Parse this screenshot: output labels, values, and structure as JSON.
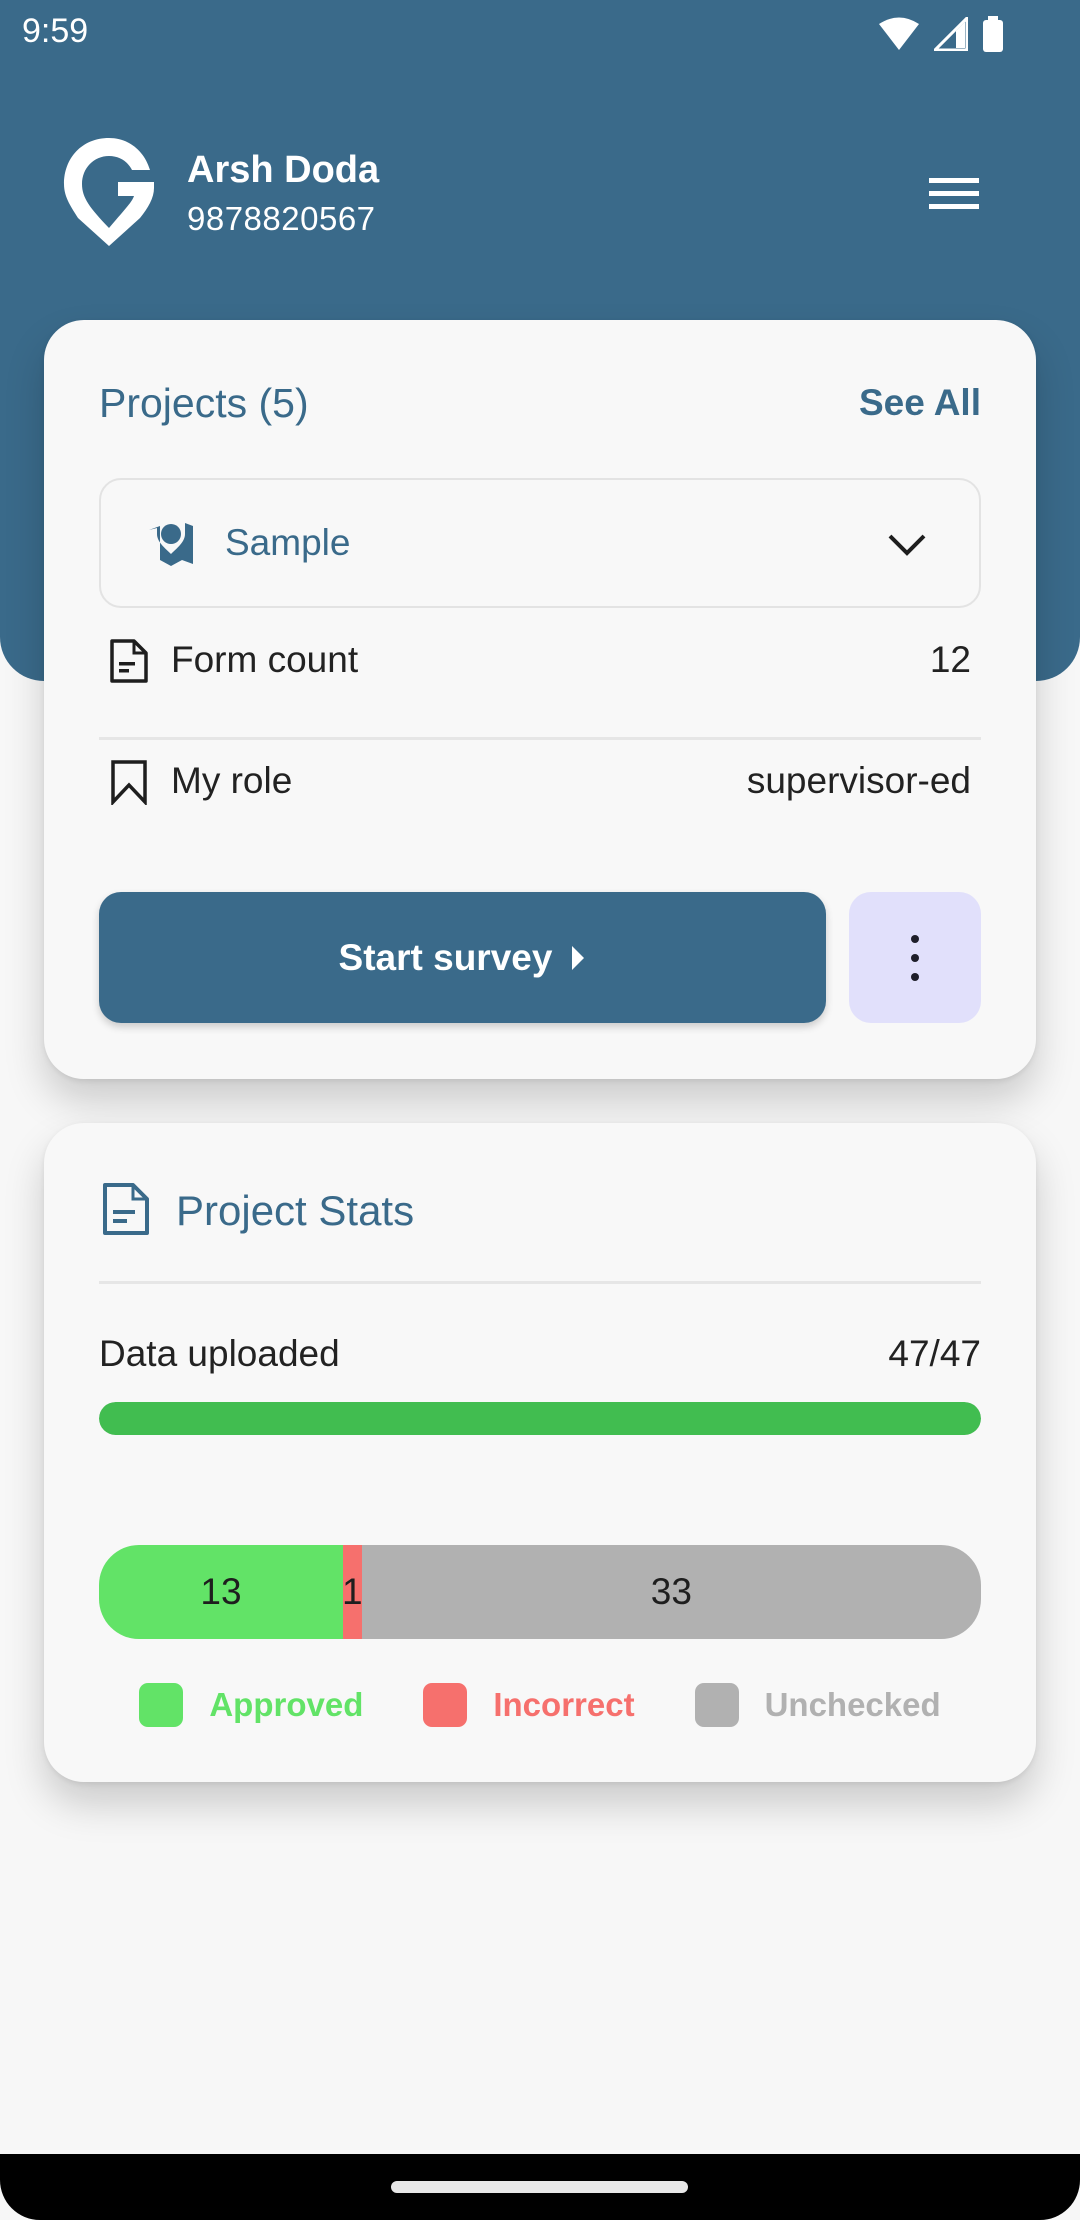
{
  "status_bar": {
    "time": "9:59",
    "icons": [
      "wifi-icon",
      "cellular-signal-icon",
      "battery-icon"
    ]
  },
  "header": {
    "logo": "g-location-pin-logo",
    "user_name": "Arsh Doda",
    "user_phone": "9878820567",
    "menu_icon": "hamburger-menu-icon"
  },
  "projects_card": {
    "title": "Projects (5)",
    "see_all_label": "See All",
    "selected_project": {
      "icon": "map-pin-icon",
      "label": "Sample"
    },
    "rows": [
      {
        "icon": "document-icon",
        "label": "Form count",
        "value": "12"
      },
      {
        "icon": "bookmark-icon",
        "label": "My role",
        "value": "supervisor-ed"
      }
    ],
    "start_button_label": "Start survey",
    "start_button_icon": "play-arrow-icon",
    "more_button_icon": "more-vertical-icon"
  },
  "stats_card": {
    "title": "Project Stats",
    "title_icon": "document-icon",
    "upload_label": "Data uploaded",
    "upload_value": "47/47",
    "upload_progress": 1.0,
    "colors": {
      "upload": "#41bd50",
      "approved": "#62e367",
      "incorrect": "#f6706d",
      "unchecked": "#b1b1b1",
      "accent": "#3a6a8a"
    }
  },
  "chart_data": {
    "type": "bar",
    "orientation": "horizontal-stacked",
    "title": "",
    "categories": [
      "Approved",
      "Incorrect",
      "Unchecked"
    ],
    "values": [
      13,
      1,
      33
    ],
    "total": 47,
    "data_labels": [
      "13",
      "1",
      "33"
    ],
    "legend": [
      "Approved",
      "Incorrect",
      "Unchecked"
    ],
    "legend_position": "bottom",
    "colors": [
      "#62e367",
      "#f6706d",
      "#b1b1b1"
    ]
  }
}
